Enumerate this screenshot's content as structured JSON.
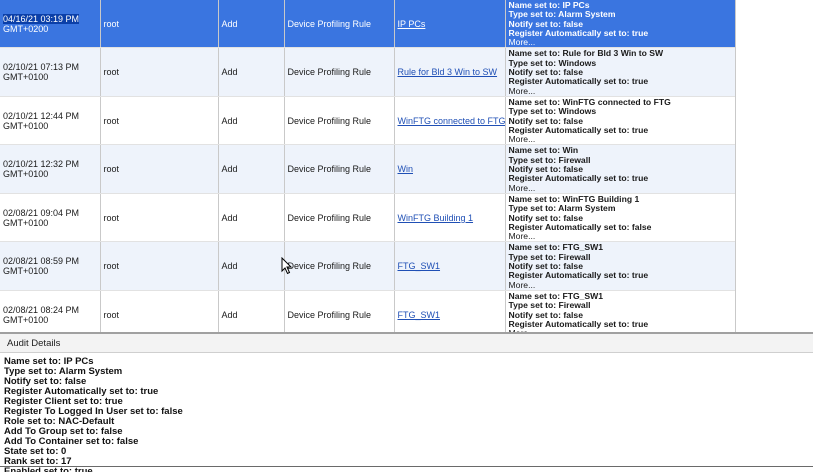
{
  "audit_rows": [
    {
      "date": "04/16/21 03:19 PM",
      "tz": "GMT+0200",
      "user": "root",
      "action": "Add",
      "type": "Device Profiling Rule",
      "rule": "IP PCs",
      "details": [
        "Name set to: IP PCs",
        "Type set to: Alarm System",
        "Notify set to: false",
        "Register Automatically set to: true"
      ],
      "more": "More...",
      "selected": true
    },
    {
      "date": "02/10/21 07:13 PM",
      "tz": "GMT+0100",
      "user": "root",
      "action": "Add",
      "type": "Device Profiling Rule",
      "rule": "Rule for Bld 3 Win to SW",
      "details": [
        "Name set to: Rule for Bld 3 Win to SW",
        "Type set to: Windows",
        "Notify set to: false",
        "Register Automatically set to: true"
      ],
      "more": "More..."
    },
    {
      "date": "02/10/21 12:44 PM",
      "tz": "GMT+0100",
      "user": "root",
      "action": "Add",
      "type": "Device Profiling Rule",
      "rule": "WinFTG connected to FTG",
      "details": [
        "Name set to: WinFTG connected to FTG",
        "Type set to: Windows",
        "Notify set to: false",
        "Register Automatically set to: true"
      ],
      "more": "More..."
    },
    {
      "date": "02/10/21 12:32 PM",
      "tz": "GMT+0100",
      "user": "root",
      "action": "Add",
      "type": "Device Profiling Rule",
      "rule": "Win",
      "details": [
        "Name set to: Win",
        "Type set to: Firewall",
        "Notify set to: false",
        "Register Automatically set to: true"
      ],
      "more": "More..."
    },
    {
      "date": "02/08/21 09:04 PM",
      "tz": "GMT+0100",
      "user": "root",
      "action": "Add",
      "type": "Device Profiling Rule",
      "rule": "WinFTG Building 1",
      "details": [
        "Name set to: WinFTG Building 1",
        "Type set to: Alarm System",
        "Notify set to: false",
        "Register Automatically set to: false"
      ],
      "more": "More..."
    },
    {
      "date": "02/08/21 08:59 PM",
      "tz": "GMT+0100",
      "user": "root",
      "action": "Add",
      "type": "Device Profiling Rule",
      "rule": "FTG_SW1",
      "details": [
        "Name set to: FTG_SW1",
        "Type set to: Firewall",
        "Notify set to: false",
        "Register Automatically set to: true"
      ],
      "more": "More..."
    },
    {
      "date": "02/08/21 08:24 PM",
      "tz": "GMT+0100",
      "user": "root",
      "action": "Add",
      "type": "Device Profiling Rule",
      "rule": "FTG_SW1",
      "details": [
        "Name set to: FTG_SW1",
        "Type set to: Firewall",
        "Notify set to: false",
        "Register Automatically set to: true"
      ],
      "more": "More..."
    }
  ],
  "details_panel": {
    "title": "Audit Details",
    "lines": [
      "Name set to: IP PCs",
      "Type set to: Alarm System",
      "Notify set to: false",
      "Register Automatically set to: true",
      "Register Client set to: true",
      "Register To Logged In User set to: false",
      "Role set to: NAC-Default",
      "Add To Group set to: false",
      "Add To Container set to: false",
      "State set to: 0",
      "Rank set to: 17",
      "Enabled set to: true"
    ]
  },
  "colors": {
    "selected_row": "#3a75e0",
    "alt_row": "#eef3fb",
    "link": "#1f4fb5"
  },
  "icons": {
    "cursor": "mouse-pointer-icon"
  }
}
